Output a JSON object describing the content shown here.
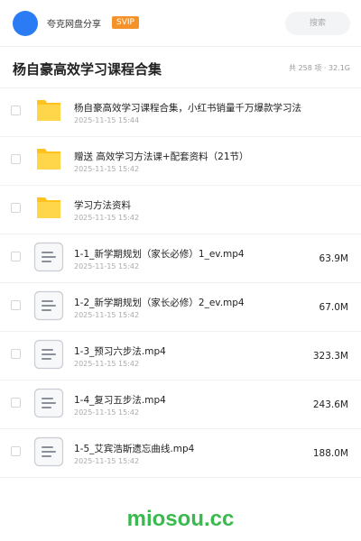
{
  "header": {
    "share_name": "夸克网盘分享",
    "badge": "SVIP",
    "search_placeholder": "搜索"
  },
  "title": "杨自豪高效学习课程合集",
  "summary": "共 258 项 · 32.1G",
  "files": [
    {
      "type": "folder",
      "name": "杨自豪高效学习课程合集，小红书销量千万爆款学习法",
      "date": "2025-11-15 15:44",
      "size": ""
    },
    {
      "type": "folder",
      "name": "赠送 高效学习方法课+配套资料（21节）",
      "date": "2025-11-15 15:42",
      "size": ""
    },
    {
      "type": "folder",
      "name": "学习方法资料",
      "date": "2025-11-15 15:42",
      "size": ""
    },
    {
      "type": "file",
      "name": "1-1_新学期规划（家长必修）1_ev.mp4",
      "date": "2025-11-15 15:42",
      "size": "63.9M"
    },
    {
      "type": "file",
      "name": "1-2_新学期规划（家长必修）2_ev.mp4",
      "date": "2025-11-15 15:42",
      "size": "67.0M"
    },
    {
      "type": "file",
      "name": "1-3_预习六步法.mp4",
      "date": "2025-11-15 15:42",
      "size": "323.3M"
    },
    {
      "type": "file",
      "name": "1-4_复习五步法.mp4",
      "date": "2025-11-15 15:42",
      "size": "243.6M"
    },
    {
      "type": "file",
      "name": "1-5_艾宾浩斯遗忘曲线.mp4",
      "date": "2025-11-15 15:42",
      "size": "188.0M"
    }
  ],
  "watermark": "miosou.cc",
  "colors": {
    "avatar": "#2b7bf5",
    "svip": "#f5932b",
    "folder": "#ffcc33",
    "watermark": "#3aba4e"
  }
}
